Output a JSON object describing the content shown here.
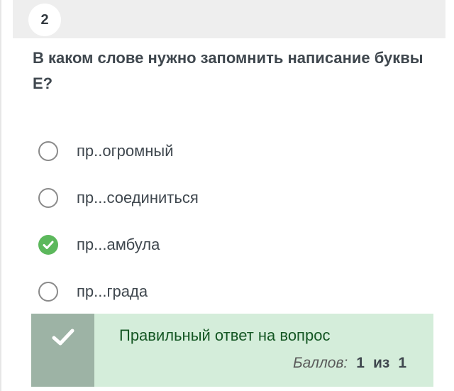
{
  "question": {
    "number": "2",
    "text": "В каком слове нужно запомнить написание буквы Е?"
  },
  "options": [
    {
      "label": "пр..огромный",
      "selected": false
    },
    {
      "label": "пр...соединиться",
      "selected": false
    },
    {
      "label": "пр...амбула",
      "selected": true
    },
    {
      "label": "пр...града",
      "selected": false
    }
  ],
  "feedback": {
    "title": "Правильный ответ на вопрос",
    "score_label": "Баллов:",
    "score_value": "1",
    "score_separator": "из",
    "score_max": "1",
    "icon": "check-icon"
  },
  "colors": {
    "accent_green": "#5cb85c",
    "feedback_bg": "#d4edda",
    "feedback_icon_bg": "#9db3a5",
    "feedback_text": "#155724",
    "header_bg": "#eeeeee"
  }
}
